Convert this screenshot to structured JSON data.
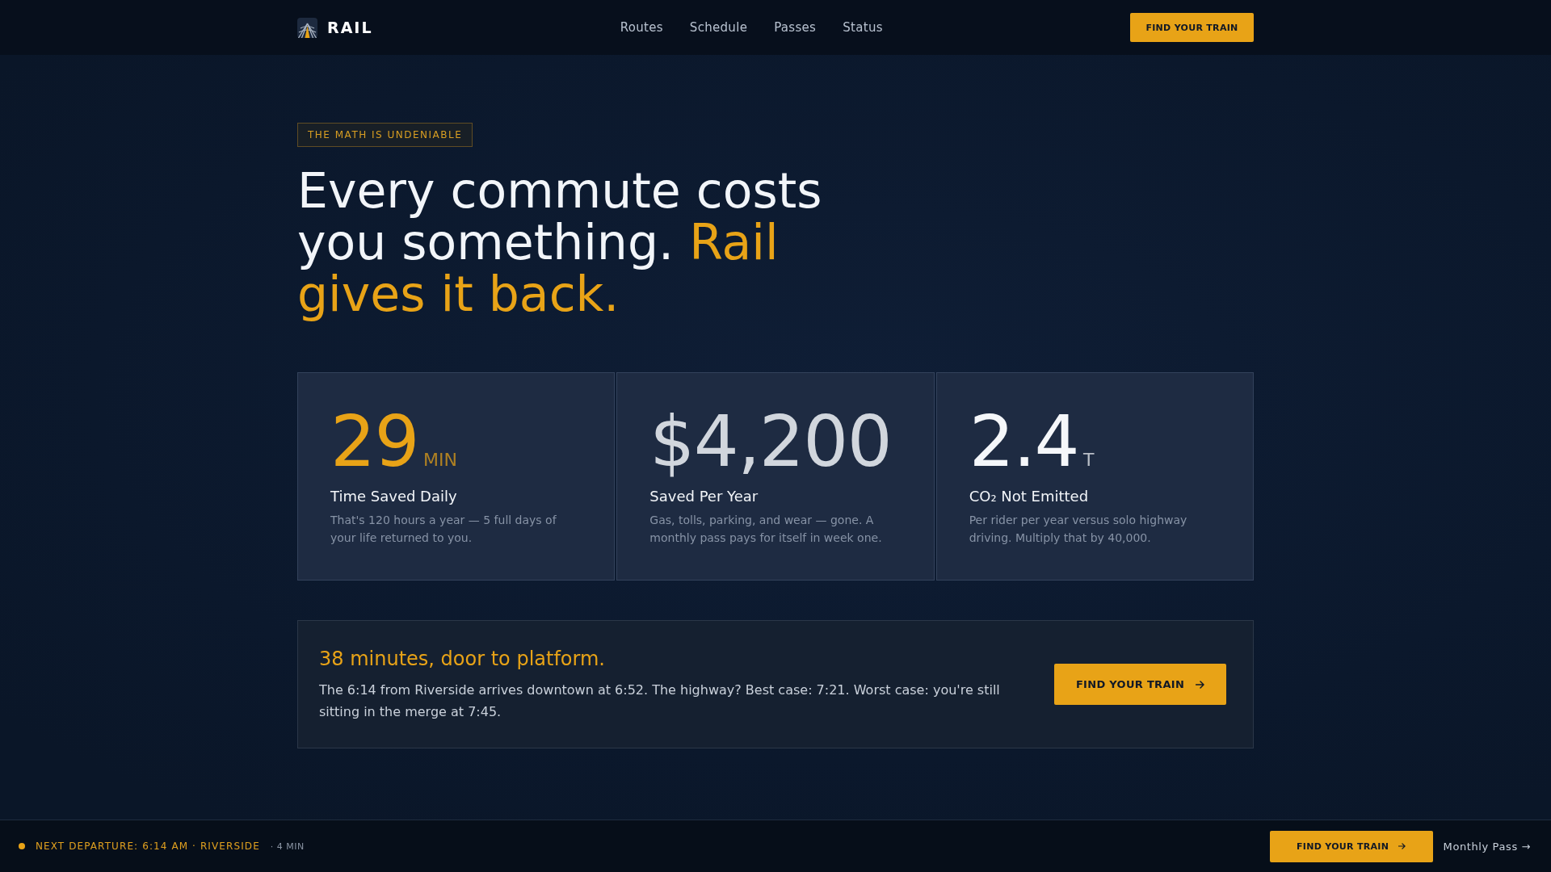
{
  "header": {
    "brand": "RAIL",
    "nav": [
      "Routes",
      "Schedule",
      "Passes",
      "Status"
    ],
    "button": "FIND YOUR TRAIN"
  },
  "hero": {
    "tag": "THE MATH IS UNDENIABLE",
    "headline": "Every commute costs you something.",
    "headline_accent": "Rail gives it back."
  },
  "stats": [
    {
      "value": "29",
      "unit": "MIN",
      "color": "#e8a317",
      "label": "Time Saved Daily",
      "description": "That's 120 hours a year — 5 full days of your life returned to you."
    },
    {
      "value": "$4,200",
      "color": "#d1d6dd",
      "label": "Saved Per Year",
      "description": "Gas, tolls, parking, and wear — gone. A monthly pass pays for itself in week one."
    },
    {
      "value": "2.4",
      "unit": "T",
      "color": "#f5f7fa",
      "label": "CO₂ Not Emitted",
      "description": "Per rider per year versus solo highway driving. Multiply that by 40,000."
    }
  ],
  "cta": {
    "title": "38 minutes, door to platform.",
    "body": "The 6:14 from Riverside arrives downtown at 6:52. The highway? Best case: 7:21. Worst case: you're still sitting in the merge at 7:45.",
    "button": "FIND YOUR TRAIN"
  },
  "bottom_bar": {
    "departure": "NEXT DEPARTURE: 6:14 AM · RIVERSIDE",
    "countdown": "· 4 MIN",
    "button": "FIND YOUR TRAIN",
    "link": "Monthly Pass →"
  }
}
